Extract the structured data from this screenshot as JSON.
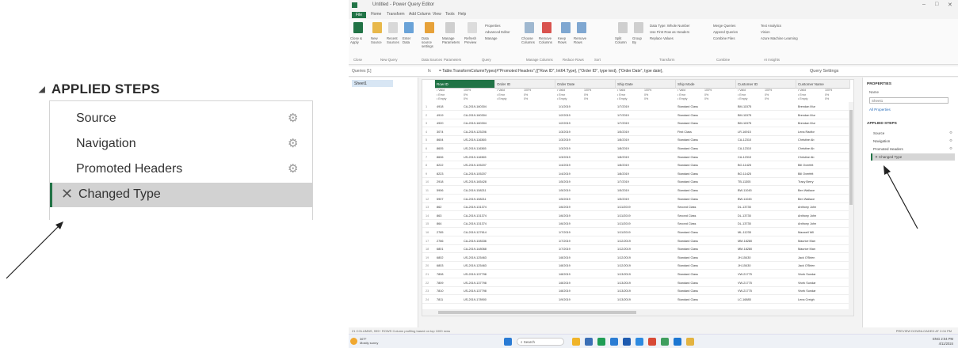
{
  "callout": {
    "header": "APPLIED STEPS",
    "steps": [
      {
        "label": "Source"
      },
      {
        "label": "Navigation"
      },
      {
        "label": "Promoted Headers"
      },
      {
        "label": "Changed Type"
      }
    ]
  },
  "window": {
    "title": "Untitled - Power Query Editor",
    "menu": [
      "File",
      "Home",
      "Transform",
      "Add Column",
      "View",
      "Tools",
      "Help"
    ],
    "ribbon_buttons": [
      "Close & Apply",
      "New Source",
      "Recent Sources",
      "Enter Data",
      "Data source settings",
      "Manage Parameters",
      "Refresh Preview",
      "Manage",
      "Choose Columns",
      "Remove Columns",
      "Keep Rows",
      "Remove Rows",
      "Split Column",
      "Group By",
      "Merge Queries",
      "Append Queries",
      "Combine Files",
      "Text Analytics",
      "Vision",
      "Azure Machine Learning"
    ],
    "ribbon_small": [
      "Properties",
      "Advanced Editor",
      "Data Type: Whole Number",
      "Use First Row as Headers",
      "Replace Values"
    ],
    "ribbon_groups": [
      "Close",
      "New Query",
      "Data Sources",
      "Parameters",
      "Query",
      "Manage Columns",
      "Reduce Rows",
      "Sort",
      "Transform",
      "Combine",
      "AI Insights"
    ],
    "formula_label": "fx",
    "formula": "= Table.TransformColumnTypes(#\"Promoted Headers\",{{\"Row ID\", Int64.Type}, {\"Order ID\", type text}, {\"Order Date\", type date},",
    "queries_label": "Queries [1]",
    "query_item": "Sheet1",
    "query_settings_title": "Query Settings",
    "columns": [
      "Row ID",
      "Order ID",
      "Order Date",
      "Ship Date",
      "Ship Mode",
      "Customer ID",
      "Customer Name"
    ],
    "profile": {
      "valid": "Valid",
      "error": "Error",
      "empty": "Empty",
      "pct100": "100%",
      "pct0": "0%"
    },
    "rows": [
      [
        "1",
        "4918",
        "CA-2019-160304",
        "1/1/2019",
        "1/7/2019",
        "Standard Class",
        "BM-11575",
        "Brendan Mur"
      ],
      [
        "2",
        "4919",
        "CA-2019-160304",
        "1/2/2019",
        "1/7/2019",
        "Standard Class",
        "BM-11575",
        "Brendan Mur"
      ],
      [
        "3",
        "4920",
        "CA-2019-160304",
        "1/2/2019",
        "1/7/2019",
        "Standard Class",
        "BM-11575",
        "Brendan Mur"
      ],
      [
        "4",
        "3074",
        "CA-2019-125206",
        "1/3/2019",
        "1/5/2019",
        "First Class",
        "LR-16915",
        "Lena Radfor"
      ],
      [
        "5",
        "8604",
        "US-2019-116365",
        "1/3/2019",
        "1/8/2019",
        "Standard Class",
        "CA-12310",
        "Christine Ab"
      ],
      [
        "6",
        "8605",
        "US-2019-116365",
        "1/3/2019",
        "1/8/2019",
        "Standard Class",
        "CA-12310",
        "Christine Ab"
      ],
      [
        "7",
        "8606",
        "US-2019-116365",
        "1/3/2019",
        "1/8/2019",
        "Standard Class",
        "CA-12310",
        "Christine Ab"
      ],
      [
        "8",
        "8222",
        "US-2019-105207",
        "1/4/2019",
        "1/8/2019",
        "Standard Class",
        "BO-11425",
        "Bill Overfelt"
      ],
      [
        "9",
        "8223",
        "CA-2019-105207",
        "1/4/2019",
        "1/8/2019",
        "Standard Class",
        "BO-11425",
        "Bill Overfelt"
      ],
      [
        "10",
        "2918",
        "US-2019-165428",
        "1/5/2019",
        "1/7/2019",
        "Standard Class",
        "TB-11305",
        "Tracy Berry"
      ],
      [
        "11",
        "5906",
        "CA-2019-158211",
        "1/5/2019",
        "1/5/2019",
        "Standard Class",
        "BW-11045",
        "Ben Wallace"
      ],
      [
        "12",
        "5907",
        "CA-2019-158211",
        "1/5/2019",
        "1/5/2019",
        "Standard Class",
        "BW-11045",
        "Ben Wallace"
      ],
      [
        "13",
        "862",
        "CA-2019-131374",
        "1/6/2019",
        "1/11/2019",
        "Second Class",
        "DL-13735",
        "Anthony John"
      ],
      [
        "14",
        "863",
        "CA-2019-131374",
        "1/6/2019",
        "1/11/2019",
        "Second Class",
        "DL-13735",
        "Anthony John"
      ],
      [
        "15",
        "864",
        "CA-2019-131374",
        "1/6/2019",
        "1/11/2019",
        "Second Class",
        "DL-13735",
        "Anthony John"
      ],
      [
        "16",
        "2765",
        "CA-2019-127614",
        "1/7/2019",
        "1/11/2019",
        "Standard Class",
        "ML-11235",
        "Maxwell Wil"
      ],
      [
        "17",
        "2766",
        "CA-2019-108336",
        "1/7/2019",
        "1/12/2019",
        "Standard Class",
        "MM-18280",
        "Maurice Man"
      ],
      [
        "18",
        "6801",
        "CA-2019-148068",
        "1/7/2019",
        "1/12/2019",
        "Standard Class",
        "MM-18280",
        "Maurice Man"
      ],
      [
        "19",
        "6802",
        "US-2019-125463",
        "1/8/2019",
        "1/12/2019",
        "Standard Class",
        "JH-15430",
        "Jack O'Brien"
      ],
      [
        "20",
        "6803",
        "US-2019-125463",
        "1/8/2019",
        "1/12/2019",
        "Standard Class",
        "JH-15430",
        "Jack O'Brien"
      ],
      [
        "21",
        "7808",
        "US-2019-137798",
        "1/8/2019",
        "1/13/2019",
        "Standard Class",
        "VW-21775",
        "Vivek Sundar"
      ],
      [
        "22",
        "7809",
        "US-2019-137798",
        "1/8/2019",
        "1/13/2019",
        "Standard Class",
        "VW-21775",
        "Vivek Sundar"
      ],
      [
        "23",
        "7810",
        "US-2019-137798",
        "1/8/2019",
        "1/13/2019",
        "Standard Class",
        "VW-21775",
        "Vivek Sundar"
      ],
      [
        "24",
        "7811",
        "US-2019-178900",
        "1/9/2019",
        "1/13/2019",
        "Standard Class",
        "LC-16885",
        "Lena Creigh"
      ]
    ],
    "qs_properties": "PROPERTIES",
    "qs_name_label": "Name",
    "qs_name_value": "Sheet1",
    "qs_all_props": "All Properties",
    "qs_applied": "APPLIED STEPS",
    "qs_steps": [
      "Source",
      "Navigation",
      "Promoted Headers",
      "Changed Type"
    ],
    "status_left": "21 COLUMNS, 999+ ROWS   Column profiling based on top 1000 rows",
    "status_right": "PREVIEW DOWNLOADED AT 2:04 PM",
    "taskbar_weather_temp": "36°F",
    "taskbar_weather_desc": "Mostly sunny",
    "taskbar_search": "Search",
    "taskbar_time": "2:04 PM",
    "taskbar_date": "4/11/2024",
    "taskbar_lang": "ENG"
  },
  "colors": {
    "accent": "#217346",
    "selected_bg": "#d2d2d2"
  }
}
